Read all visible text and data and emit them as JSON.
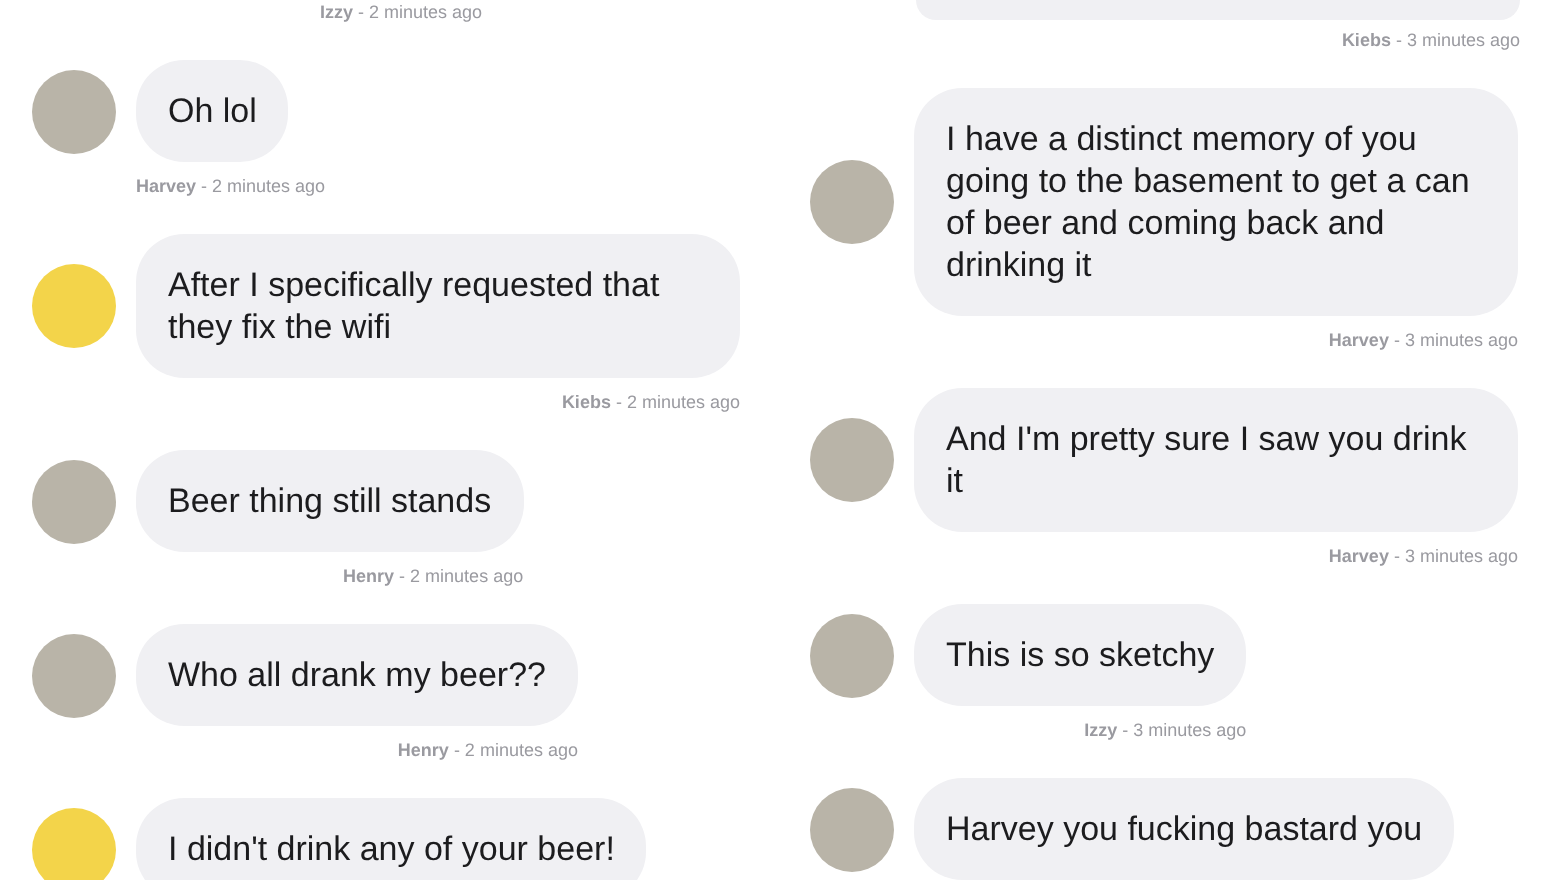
{
  "columns": [
    {
      "messages": [
        {
          "kind": "meta",
          "meta": "**Izzy** - 2 minutes ago"
        },
        {
          "kind": "message",
          "avatar": {
            "kind": "photo"
          },
          "text": "Oh lol",
          "meta": "**Harvey** - 2 minutes ago"
        },
        {
          "kind": "message",
          "avatar": {
            "kind": "cartoon"
          },
          "text": "After I specifically requested that they fix the wifi",
          "meta": "**Kiebs** - 2 minutes ago"
        },
        {
          "kind": "message",
          "avatar": {
            "kind": "photo"
          },
          "text": "Beer thing still stands",
          "meta": "**Henry** - 2 minutes ago"
        },
        {
          "kind": "message",
          "avatar": {
            "kind": "photo"
          },
          "text": "Who all drank my beer??",
          "meta": "**Henry** - 2 minutes ago"
        },
        {
          "kind": "message",
          "avatar": {
            "kind": "cartoon"
          },
          "text": "I didn't drink any of your beer!"
        }
      ]
    },
    {
      "messages": [
        {
          "kind": "tail",
          "meta": "**Kiebs** - 3 minutes ago"
        },
        {
          "kind": "message",
          "avatar": {
            "kind": "photo"
          },
          "text": "I have a distinct memory of you going to the basement to get a can of beer and coming back and drinking it",
          "meta": "**Harvey** - 3 minutes ago"
        },
        {
          "kind": "message",
          "avatar": {
            "kind": "photo"
          },
          "text": "And I'm pretty sure I saw you drink it",
          "meta": "**Harvey** - 3 minutes ago"
        },
        {
          "kind": "message",
          "avatar": {
            "kind": "photo"
          },
          "text": "This is so sketchy",
          "meta": "**Izzy** - 3 minutes ago"
        },
        {
          "kind": "message",
          "avatar": {
            "kind": "photo"
          },
          "text": "Harvey you fucking bastard you"
        }
      ]
    }
  ]
}
